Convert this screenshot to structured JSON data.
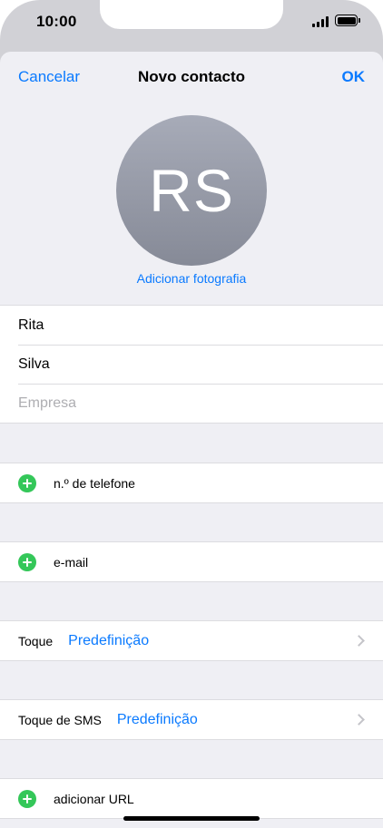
{
  "status_bar": {
    "time": "10:00"
  },
  "navbar": {
    "cancel": "Cancelar",
    "title": "Novo contacto",
    "done": "OK"
  },
  "avatar": {
    "initials": "RS",
    "add_photo": "Adicionar fotografia"
  },
  "name_fields": {
    "first_name": "Rita",
    "last_name": "Silva",
    "company_placeholder": "Empresa"
  },
  "phone": {
    "label": "n.º de telefone"
  },
  "email": {
    "label": "e-mail"
  },
  "ringtone": {
    "label": "Toque",
    "value": "Predefinição"
  },
  "text_tone": {
    "label": "Toque de SMS",
    "value": "Predefinição"
  },
  "url": {
    "label": "adicionar URL"
  },
  "colors": {
    "accent": "#0a7aff",
    "add_green": "#34c759",
    "background": "#efeff4"
  }
}
